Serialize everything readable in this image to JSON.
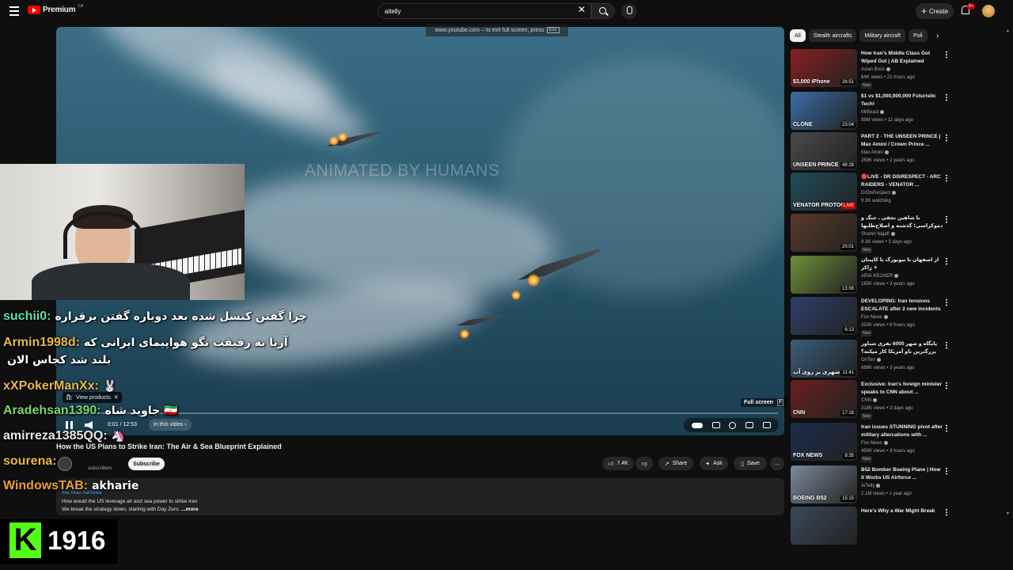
{
  "topbar": {
    "logo_text": "Premium",
    "logo_country": "CA",
    "search_value": "aitelly",
    "clear_glyph": "✕",
    "create_label": "Create",
    "notification_badge": "9+"
  },
  "player": {
    "exit_fullscreen_msg": "www.youtube.com – to exit full screen, press",
    "exit_key": "Esc",
    "watermark": "ANIMATED BY HUMANS",
    "fullscreen_tip": "Full screen",
    "fullscreen_key": "F",
    "time": "0:01 / 12:53",
    "in_this_video": "In this video ›",
    "progress": 0.0013
  },
  "video": {
    "title": "How the US Plans to Strike Iran: The Air & Sea Blueprint Explained",
    "subs": "subscribers",
    "subscribe_label": "Subscribe",
    "like_count": "7.4K",
    "share_label": "Share",
    "ask_label": "Ask",
    "save_label": "Save",
    "more_glyph": "…",
    "tags": "#us #iran #airstrike",
    "desc_line1": "How would the US leverage air and sea power to strike Iran",
    "desc_line2": "We break the strategy down, starting with Day Zero.",
    "desc_more": " ...more"
  },
  "chips": [
    "All",
    "Stealth aircrafts",
    "Military aircraft",
    "Poli"
  ],
  "recommendations": [
    {
      "title": "How Iran's Middle Class Got Wiped Out | AB Explained",
      "channel": "Asian Boss",
      "meta": "84K views • 21 hours ago",
      "badge": "New",
      "duration": "26:51",
      "overlay": "$3,000 iPhone",
      "thumb": "#8a1f1f"
    },
    {
      "title": "$1 vs $1,000,000,000 Futuristic Tech!",
      "channel": "MrBeast",
      "meta": "88M views • 11 days ago",
      "badge": "",
      "duration": "23:04",
      "overlay": "CLONE",
      "thumb": "#3b6ea5"
    },
    {
      "title": "PART 2 - THE UNSEEN PRINCE | Max Amini / Crown Prince ...",
      "channel": "Max Amini",
      "meta": "269K views • 2 years ago",
      "badge": "",
      "duration": "48:28",
      "overlay": "UNSEEN PRINCE",
      "thumb": "#4a4a4a"
    },
    {
      "title": "🔴LIVE - DR DISRESPECT - ARC RAIDERS - VENATOR ...",
      "channel": "DrDisRespect",
      "meta": "9.3K watching",
      "badge": "",
      "duration": "LIVE",
      "overlay": "VENATOR PROTOCOL",
      "thumb": "#1f4d5a"
    },
    {
      "title": "با شاهین نجفی ـ جنگ و دموکراسی؛ گذشته و اصلاح‌طلبها",
      "channel": "Shahin Najafi",
      "meta": "8.3K views • 3 days ago",
      "badge": "New",
      "duration": "20:01",
      "overlay": "",
      "thumb": "#5a3a2a"
    },
    {
      "title": "از اصفهان تا نیویورک با کاپیتان زاکر ✈",
      "channel": "ARIA KEOXER",
      "meta": "185K views • 3 years ago",
      "badge": "",
      "duration": "13:08",
      "overlay": "",
      "thumb": "#6f8f3a"
    },
    {
      "title": "DEVELOPING: Iran tensions ESCALATE after 2 new incidents",
      "channel": "Fox News",
      "meta": "253K views • 6 hours ago",
      "badge": "New",
      "duration": "6:13",
      "overlay": "",
      "thumb": "#2d3f6b"
    },
    {
      "title": "پایگاه و شهر 6000 نفری شناور بزرگترین ناو آمریکا کار میکنه؟",
      "channel": "OnTen",
      "meta": "688K views • 3 years ago",
      "badge": "",
      "duration": "11:41",
      "overlay": "شهری بر روی آب",
      "thumb": "#3a5d7a"
    },
    {
      "title": "Exclusive: Iran's foreign minister speaks to CNN about ...",
      "channel": "CNN",
      "meta": "318K views • 2 days ago",
      "badge": "New",
      "duration": "17:16",
      "overlay": "CNN",
      "thumb": "#6b2020"
    },
    {
      "title": "Iran issues STUNNING pivot after military altercations with ...",
      "channel": "Fox News",
      "meta": "450K views • 3 hours ago",
      "badge": "New",
      "duration": "8:35",
      "overlay": "FOX NEWS",
      "thumb": "#1c2c4d"
    },
    {
      "title": "B52 Bomber Boeing Plane | How it Works US Airforce ...",
      "channel": "AiTelly",
      "meta": "2.1M views • 1 year ago",
      "badge": "",
      "duration": "15:15",
      "overlay": "BOEING B52",
      "thumb": "#7a8a9a"
    },
    {
      "title": "Here's Why a War Might Break",
      "channel": "",
      "meta": "",
      "badge": "",
      "duration": "",
      "overlay": "",
      "thumb": "#3a4a5a"
    }
  ],
  "stream": {
    "chat": [
      {
        "user": "suchii0:",
        "color": "#5fe0a8",
        "msg": "چرا گفتن کنسل شده بعد دوباره گفتن برقراره"
      },
      {
        "user": "Armin1998d:",
        "color": "#e8b84a",
        "msg": "آریا به رفیقت بگو هواپیمای ایرانی که"
      },
      {
        "user": "",
        "color": "#e8b84a",
        "msg": "بلند شد کجاس الان"
      },
      {
        "user": "xXPokerManXx:",
        "color": "#e8b84a",
        "msg": "🐰"
      },
      {
        "user": "Aradehsan1390:",
        "color": "#7ad86a",
        "msg": "جاوید شاه 🇮🇷"
      },
      {
        "user": "amirreza1385QQ:",
        "color": "#e8e8e8",
        "msg": "🦄"
      },
      {
        "user": "sourena:",
        "color": "#e8b84a",
        "msg": ""
      },
      {
        "user": "WindowsTAB:",
        "color": "#e8a23a",
        "msg": "akharie"
      }
    ],
    "view_products": "View products",
    "viewer_count": "1916",
    "kick_letter": "K"
  },
  "colors": {
    "accent_red": "#ff0000",
    "kick_green": "#53fc18"
  }
}
